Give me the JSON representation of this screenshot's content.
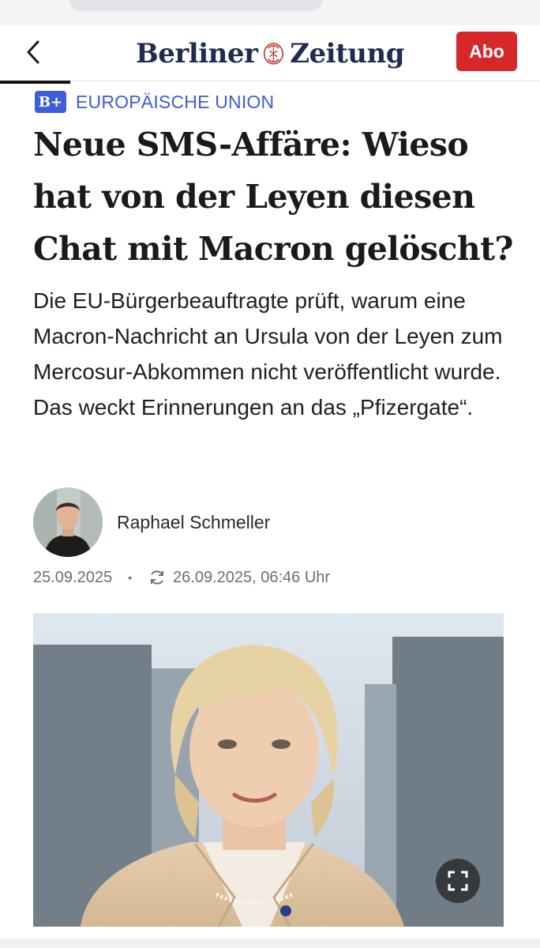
{
  "header": {
    "logo_word_left": "Berliner",
    "logo_word_right": "Zeitung",
    "abo_label": "Abo",
    "reading_progress": 0.13
  },
  "article": {
    "badge": "B+",
    "category": "EUROPÄISCHE UNION",
    "headline": "Neue SMS-Affäre: Wieso hat von der Leyen diesen Chat mit Macron gelöscht?",
    "lead": "Die EU-Bürgerbeauftragte prüft, warum eine Macron-Nachricht an Ursula von der Leyen zum Mercosur-Abkommen nicht veröffentlicht wurde. Das weckt Erinnerungen an das „Pfizergate“.",
    "author": "Raphael Schmeller",
    "published": "25.09.2025",
    "updated": "26.09.2025, 06:46 Uhr"
  },
  "colors": {
    "brand_navy": "#1d2c4f",
    "logo_red": "#c8322e",
    "abo_red": "#d62828",
    "category_blue": "#3d5ed8"
  },
  "icons": {
    "back": "chevron-left-icon",
    "update": "refresh-icon",
    "expand": "fullscreen-icon"
  }
}
